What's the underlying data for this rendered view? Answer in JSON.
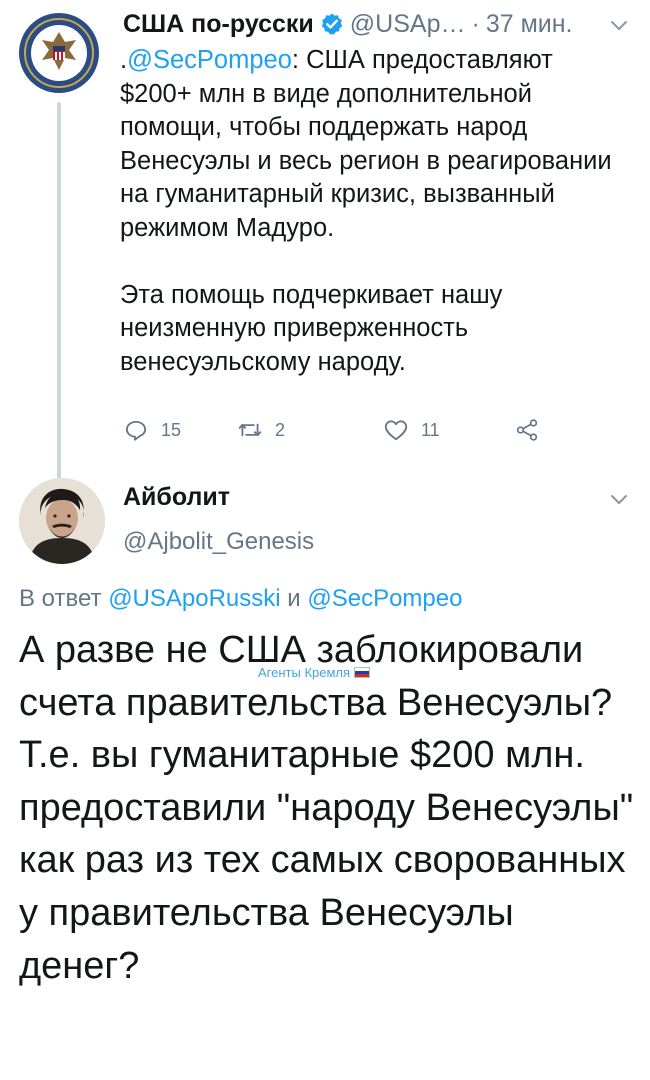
{
  "tweet1": {
    "author_name": "США по-русски",
    "handle": "@USAp…",
    "separator": "·",
    "time": "37 мин.",
    "body_prefix": ".",
    "body_mention": "@SecPompeo",
    "body_text": ": США предоставляют $200+ млн в виде дополнительной помощи, чтобы поддержать народ Венесуэлы и весь регион в реагировании на гуманитарный кризис, вызванный режимом Мадуро.",
    "body_text_2": "Эта помощь подчеркивает нашу неизменную приверженность венесуэльскому народу.",
    "actions": {
      "replies": "15",
      "retweets": "2",
      "likes": "11"
    }
  },
  "tweet2": {
    "author_name": "Айболит",
    "handle": "@Ajbolit_Genesis",
    "reply_prefix": "В ответ ",
    "reply_mention_1": "@USApoRusski",
    "reply_and": " и ",
    "reply_mention_2": "@SecPompeo",
    "body_text": "А разве не США заблокировали счета правительства Венесуэлы? Т.е. вы гуманитарные $200 млн. предоставили \"народу Венесуэлы\" как раз из тех самых своровaнных у правительства Венесуэлы денег?"
  },
  "watermark": {
    "text": "Агенты Кремля"
  },
  "colors": {
    "link": "#1da1f2",
    "secondary": "#657786",
    "thread": "#ccd6dd",
    "text": "#14171a"
  },
  "icons": [
    "state-department-seal",
    "verified-badge",
    "chevron-down",
    "reply",
    "retweet",
    "like",
    "share"
  ]
}
